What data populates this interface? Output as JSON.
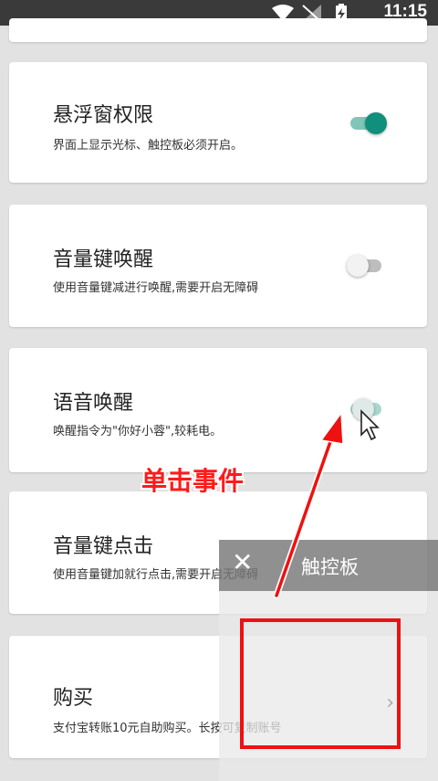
{
  "status_bar": {
    "time": "11:15"
  },
  "settings": [
    {
      "title": "悬浮窗权限",
      "desc": "界面上显示光标、触控板必须开启。",
      "toggle": "on"
    },
    {
      "title": "音量键唤醒",
      "desc": "使用音量键减进行唤醒,需要开启无障碍",
      "toggle": "off"
    },
    {
      "title": "语音唤醒",
      "desc": "唤醒指令为\"你好小蓉\",较耗电。",
      "toggle": "mid"
    },
    {
      "title": "音量键点击",
      "desc": "使用音量键加就行点击,需要开启无障碍"
    },
    {
      "title": "购买",
      "desc": "支付宝转账10元自助购买。长按可复制账号"
    }
  ],
  "annotation": {
    "label": "单击事件"
  },
  "touchpad_panel": {
    "close_symbol": "✕",
    "title": "触控板",
    "chevron": "›"
  },
  "colors": {
    "accent": "#0f8f7c",
    "annotation_red": "#ff1a1a"
  }
}
